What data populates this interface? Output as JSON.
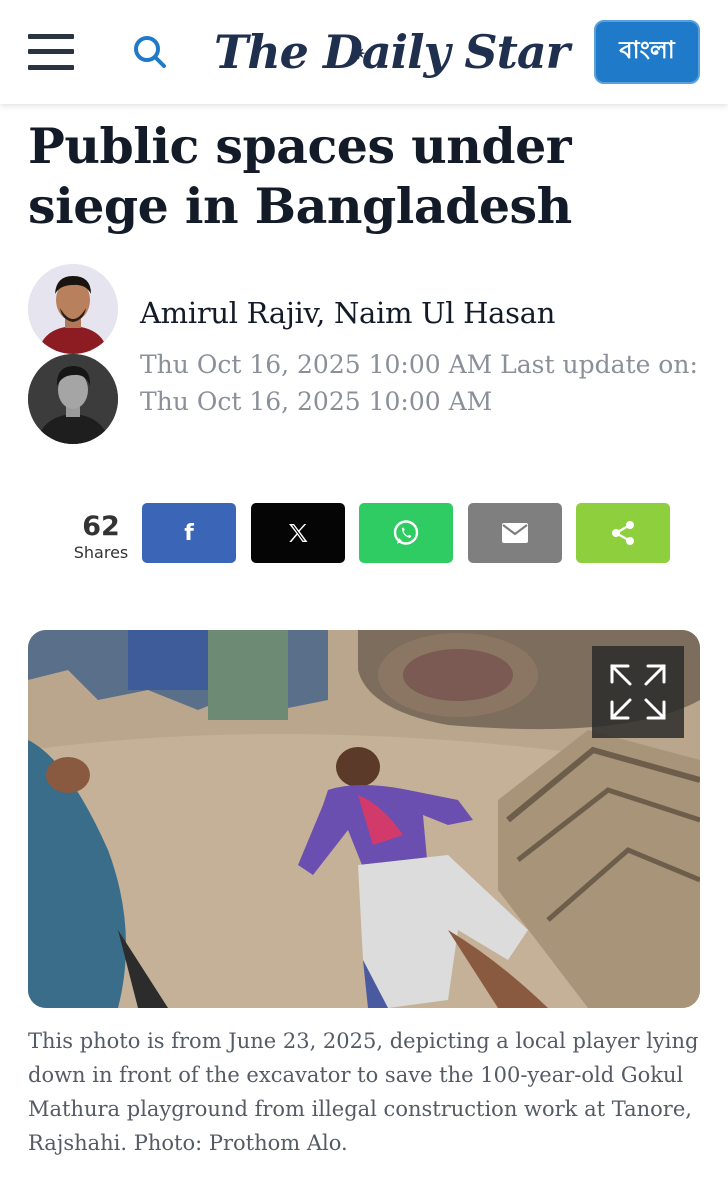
{
  "header": {
    "logo_text": "The Daily Star",
    "language_button": "বাংলা",
    "icons": {
      "menu": "hamburger-menu-icon",
      "search": "search-icon"
    },
    "colors": {
      "logo": "#1f2f4e",
      "language_button": "#1f7bc9"
    }
  },
  "article": {
    "headline": "Public spaces under siege in Bangladesh",
    "authors": "Amirul Rajiv, Naim Ul Hasan",
    "dateline": "Thu Oct 16, 2025 10:00 AM Last update on: Thu Oct 16, 2025 10:00 AM"
  },
  "share": {
    "count": "62",
    "label": "Shares",
    "buttons": [
      {
        "icon": "facebook-icon",
        "color": "#3b65b7"
      },
      {
        "icon": "x-icon",
        "color": "#050505"
      },
      {
        "icon": "whatsapp-icon",
        "color": "#2ecc63"
      },
      {
        "icon": "email-icon",
        "color": "#7f7f7f"
      },
      {
        "icon": "share-icon",
        "color": "#8ecf3e"
      }
    ]
  },
  "photo": {
    "expand_icon": "expand-icon",
    "caption": "This photo is from June 23, 2025, depicting a local player lying down in front of the excavator to save the 100-year-old Gokul Mathura playground from illegal construction work at Tanore, Rajshahi. Photo: Prothom Alo."
  }
}
